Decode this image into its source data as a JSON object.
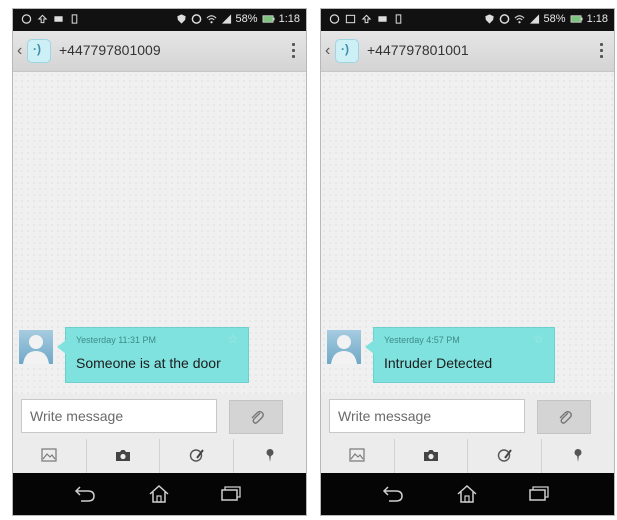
{
  "screens": [
    {
      "status_bar": {
        "battery": "58%",
        "time": "1:18"
      },
      "contact": {
        "number": "+447797801009"
      },
      "message": {
        "time": "Yesterday 11:31 PM",
        "text": "Someone is at the door"
      },
      "compose": {
        "placeholder": "Write message"
      }
    },
    {
      "status_bar": {
        "battery": "58%",
        "time": "1:18"
      },
      "contact": {
        "number": "+447797801001"
      },
      "message": {
        "time": "Yesterday 4:57 PM",
        "text": "Intruder Detected"
      },
      "compose": {
        "placeholder": "Write message"
      }
    }
  ],
  "icons": {
    "status_left": [
      "whatsapp-icon",
      "upload-icon",
      "message-icon",
      "phone-icon"
    ],
    "status_right": [
      "shield-icon",
      "circle-icon",
      "wifi-icon",
      "signal-icon",
      "battery-icon"
    ],
    "toolbar": [
      "image-icon",
      "camera-icon",
      "draw-icon",
      "location-icon"
    ],
    "nav": [
      "back-icon",
      "home-icon",
      "recent-apps-icon"
    ]
  },
  "colors": {
    "bubble": "#7fe2de",
    "status_bar": "#111111",
    "nav_bar": "#050505",
    "background": "#f0f0f0"
  }
}
